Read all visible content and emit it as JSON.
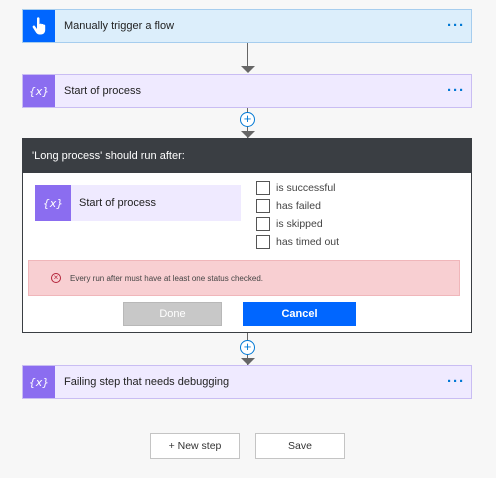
{
  "colors": {
    "accent": "#0066ff",
    "trigger_bg": "#dceefb",
    "action_bg": "#efeaff",
    "action_icon": "#8b6df0",
    "dialog_header": "#3a3e43",
    "error_bg": "#f8cfd2"
  },
  "flow": {
    "trigger": {
      "label": "Manually trigger a flow",
      "icon": "hand-pointer-icon",
      "more": "···"
    },
    "step1": {
      "label": "Start of process",
      "icon": "variable-braces-icon",
      "more": "···"
    },
    "step3": {
      "label": "Failing step that needs debugging",
      "icon": "variable-braces-icon",
      "more": "···"
    },
    "add_symbol": "+"
  },
  "dialog": {
    "title": "'Long process' should run after:",
    "reference_step": {
      "label": "Start of process",
      "icon": "variable-braces-icon"
    },
    "statuses": [
      {
        "label": "is successful",
        "checked": false
      },
      {
        "label": "has failed",
        "checked": false
      },
      {
        "label": "is skipped",
        "checked": false
      },
      {
        "label": "has timed out",
        "checked": false
      }
    ],
    "error_text": "Every run after must have at least one status checked.",
    "done_label": "Done",
    "cancel_label": "Cancel"
  },
  "footer": {
    "new_step_label": "+ New step",
    "save_label": "Save"
  }
}
